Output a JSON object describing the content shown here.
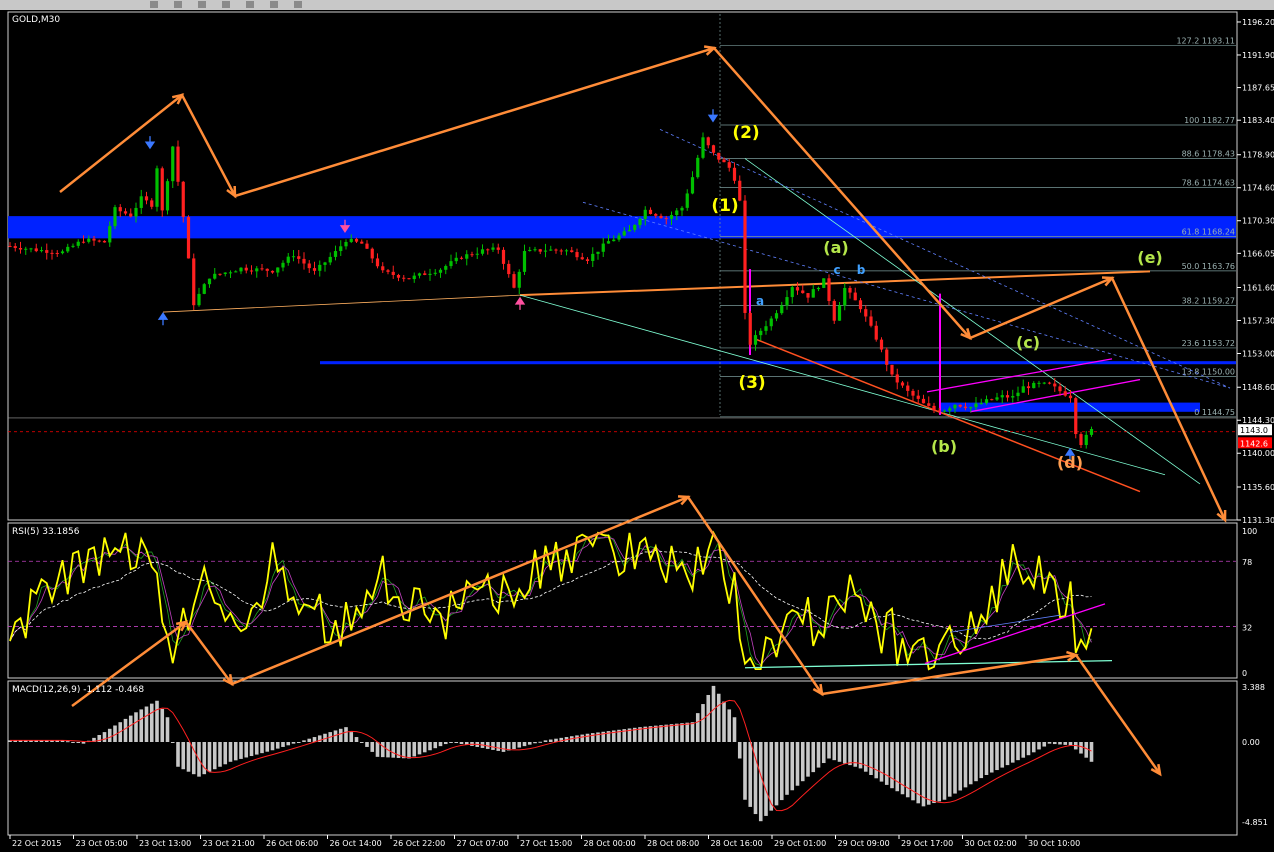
{
  "toolbar": {
    "buttons": [
      "nav-left-button",
      "nav-right-button",
      "line-tool-button",
      "new-order-button",
      "zoom-button",
      "settings-button",
      "chart-button"
    ]
  },
  "panels": {
    "main": {
      "label": "GOLD,M30"
    },
    "rsi": {
      "label": "RSI(5) 33.1856"
    },
    "macd": {
      "label": "MACD(12,26,9) -1.112 -0.468"
    }
  },
  "colors": {
    "bull": "#00c000",
    "bear": "#ff2020",
    "zone": "#0022ff",
    "arrow": "#ff8c38",
    "magenta": "#ff00ff",
    "cyan": "#7fffd4",
    "wave_yellow": "#ffff00",
    "wave_green": "#b4e64a",
    "wave_cyan": "#40a0ff",
    "rsi": "#ffff00",
    "macd_hist": "#c8c8c8",
    "macd_signal": "#ff2020",
    "price_tag": "#ff0000"
  },
  "chart_data": [
    {
      "type": "candlestick",
      "title": "GOLD,M30",
      "ylim": [
        1131.3,
        1197.5
      ],
      "y_ticks": [
        "1196.20",
        "1191.90",
        "1187.65",
        "1183.40",
        "1178.90",
        "1174.60",
        "1170.30",
        "1166.05",
        "1161.60",
        "1157.30",
        "1153.00",
        "1148.60",
        "1144.30",
        "1140.00",
        "1135.60",
        "1131.30"
      ],
      "current_price": "1143.0",
      "bid_price": "1142.6",
      "x_ticks": [
        "22 Oct 2015",
        "23 Oct 05:00",
        "23 Oct 13:00",
        "23 Oct 21:00",
        "26 Oct 06:00",
        "26 Oct 14:00",
        "26 Oct 22:00",
        "27 Oct 07:00",
        "27 Oct 15:00",
        "28 Oct 00:00",
        "28 Oct 08:00",
        "28 Oct 16:00",
        "29 Oct 01:00",
        "29 Oct 09:00",
        "29 Oct 17:00",
        "30 Oct 02:00",
        "30 Oct 10:00"
      ],
      "close_path": [
        [
          0,
          1167.0
        ],
        [
          5,
          1166.5
        ],
        [
          10,
          1166.2
        ],
        [
          14,
          1167.8
        ],
        [
          18,
          1167.5
        ],
        [
          20,
          1171.8
        ],
        [
          23,
          1171.0
        ],
        [
          25,
          1173.2
        ],
        [
          27,
          1172.4
        ],
        [
          28,
          1177.3
        ],
        [
          29,
          1171.5
        ],
        [
          31,
          1180.0
        ],
        [
          33,
          1170.8
        ],
        [
          35,
          1159.5
        ],
        [
          38,
          1163.0
        ],
        [
          44,
          1164.1
        ],
        [
          50,
          1163.8
        ],
        [
          54,
          1165.9
        ],
        [
          58,
          1163.6
        ],
        [
          62,
          1166.2
        ],
        [
          64,
          1167.8
        ],
        [
          67,
          1167.3
        ],
        [
          71,
          1163.6
        ],
        [
          76,
          1162.8
        ],
        [
          82,
          1164.0
        ],
        [
          86,
          1165.6
        ],
        [
          90,
          1166.4
        ],
        [
          93,
          1166.6
        ],
        [
          96,
          1161.5
        ],
        [
          98,
          1166.2
        ],
        [
          102,
          1166.5
        ],
        [
          106,
          1166.4
        ],
        [
          110,
          1165.3
        ],
        [
          114,
          1167.6
        ],
        [
          118,
          1169.0
        ],
        [
          121,
          1171.7
        ],
        [
          125,
          1170.6
        ],
        [
          128,
          1172.0
        ],
        [
          130,
          1176.0
        ],
        [
          132,
          1181.0
        ],
        [
          134,
          1179.0
        ],
        [
          137,
          1177.2
        ],
        [
          138,
          1175.8
        ],
        [
          139,
          1172.8
        ],
        [
          140,
          1158.0
        ],
        [
          141,
          1154.3
        ],
        [
          143,
          1156.0
        ],
        [
          145,
          1157.5
        ],
        [
          147,
          1159.5
        ],
        [
          149,
          1161.8
        ],
        [
          152,
          1160.5
        ],
        [
          155,
          1162.5
        ],
        [
          157,
          1157.5
        ],
        [
          159,
          1161.5
        ],
        [
          162,
          1159.0
        ],
        [
          165,
          1155.0
        ],
        [
          168,
          1150.0
        ],
        [
          171,
          1148.0
        ],
        [
          174,
          1146.4
        ],
        [
          176,
          1145.6
        ],
        [
          178,
          1145.7
        ],
        [
          180,
          1146.4
        ],
        [
          183,
          1146.0
        ],
        [
          186,
          1146.8
        ],
        [
          189,
          1147.4
        ],
        [
          191,
          1147.3
        ],
        [
          193,
          1148.6
        ],
        [
          196,
          1149.0
        ],
        [
          198,
          1148.9
        ],
        [
          200,
          1148.1
        ],
        [
          202,
          1147.4
        ],
        [
          203,
          1142.8
        ],
        [
          204,
          1141.3
        ],
        [
          206,
          1143.0
        ]
      ],
      "wave_labels": [
        {
          "text": "(2)",
          "color": "yellow"
        },
        {
          "text": "(1)",
          "color": "yellow"
        },
        {
          "text": "(3)",
          "color": "yellow"
        },
        {
          "text": "(a)",
          "color": "green"
        },
        {
          "text": "(b)",
          "color": "green"
        },
        {
          "text": "(c)",
          "color": "green"
        },
        {
          "text": "(d)",
          "color": "orange"
        },
        {
          "text": "(e)",
          "color": "green"
        },
        {
          "text": "a",
          "color": "cyan"
        },
        {
          "text": "b",
          "color": "cyan"
        },
        {
          "text": "c",
          "color": "cyan"
        }
      ],
      "fibonacci": [
        {
          "label": "127.2 1193.11",
          "price": 1193.11
        },
        {
          "label": "100 1182.77",
          "price": 1182.77
        },
        {
          "label": "88.6 1178.43",
          "price": 1178.43
        },
        {
          "label": "78.6 1174.63",
          "price": 1174.63
        },
        {
          "label": "61.8 1168.24",
          "price": 1168.24
        },
        {
          "label": "50.0 1163.76",
          "price": 1163.76
        },
        {
          "label": "38.2 1159.27",
          "price": 1159.27
        },
        {
          "label": "23.6 1153.72",
          "price": 1153.72
        },
        {
          "label": "13.8 1150.00",
          "price": 1150.0
        },
        {
          "label": "0 1144.75",
          "price": 1144.75
        }
      ],
      "zones": [
        {
          "price_from": 1168.0,
          "price_to": 1170.9
        },
        {
          "price_from": 1151.6,
          "price_to": 1152.0
        },
        {
          "price_from": 1145.4,
          "price_to": 1146.6
        }
      ]
    },
    {
      "type": "line",
      "title": "RSI(5) 33.1856",
      "ylim": [
        0,
        100
      ],
      "y_ticks": [
        "100",
        "78",
        "32",
        "0"
      ],
      "levels": [
        78,
        32
      ]
    },
    {
      "type": "bar",
      "title": "MACD(12,26,9) -1.112 -0.468",
      "y_ticks": [
        "3.388",
        "0.00",
        "-4.851"
      ]
    }
  ]
}
